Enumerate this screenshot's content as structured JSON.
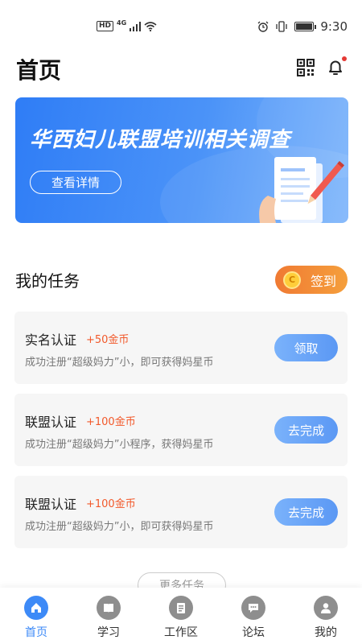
{
  "status_bar": {
    "hd": "HD",
    "network": "4G",
    "time": "9:30",
    "icons": [
      "signal-icon",
      "wifi-icon",
      "alarm-icon",
      "vibrate-icon",
      "battery-icon"
    ]
  },
  "header": {
    "title": "首页",
    "icons": [
      "qr-code-icon",
      "bell-icon"
    ]
  },
  "banner": {
    "title": "华西妇儿联盟培训相关调查",
    "button_label": "查看详情"
  },
  "tasks": {
    "section_title": "我的任务",
    "checkin_label": "签到",
    "items": [
      {
        "name": "实名认证",
        "reward": "+50金币",
        "desc": "成功注册“超级妈力”小，即可获得妈星币",
        "action": "领取"
      },
      {
        "name": "联盟认证",
        "reward": "+100金币",
        "desc": "成功注册“超级妈力”小程序，获得妈星币",
        "action": "去完成"
      },
      {
        "name": "联盟认证",
        "reward": "+100金币",
        "desc": "成功注册“超级妈力”小，即可获得妈星币",
        "action": "去完成"
      }
    ],
    "more_label": "更多任务"
  },
  "bottom_nav": {
    "active": 0,
    "items": [
      {
        "label": "首页",
        "icon": "home-icon"
      },
      {
        "label": "学习",
        "icon": "book-icon"
      },
      {
        "label": "工作区",
        "icon": "clipboard-icon"
      },
      {
        "label": "论坛",
        "icon": "chat-icon"
      },
      {
        "label": "我的",
        "icon": "user-icon"
      }
    ]
  },
  "colors": {
    "primary": "#3d8af7",
    "reward": "#f2592b",
    "checkin": "#f07a33"
  }
}
